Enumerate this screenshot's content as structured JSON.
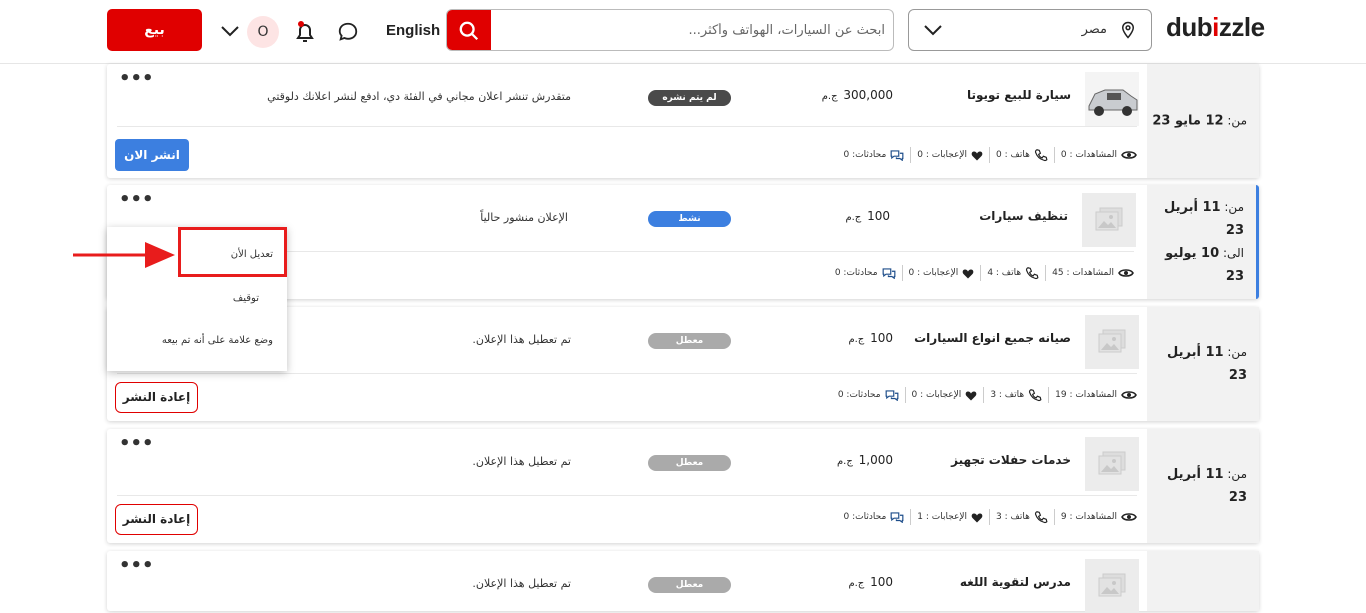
{
  "header": {
    "logo": "dubizzle",
    "location": "مصر",
    "search_placeholder": "ابحث عن السيارات، الهواتف وأكثر...",
    "language": "English",
    "avatar_letter": "O",
    "sell_label": "بيع"
  },
  "menu": {
    "items": [
      "تعديل الأن",
      "توقيف",
      "وضع علامة على أنه تم بيعه"
    ]
  },
  "listings": [
    {
      "date_from_label": "من:",
      "date_from": "12 مايو 23",
      "title": "سيارة للبيع تويوتا",
      "price": "300,000",
      "currency": "ج.م",
      "status": "لم يتم نشره",
      "note": "متقدرش تنشر اعلان مجاني في الفئة دي، ادفع لنشر اعلانك دلوقتي",
      "views": "المشاهدات : 0",
      "phone": "هاتف : 0",
      "likes": "الإعجابات : 0",
      "chats": "محادثات: 0",
      "action": "انشر الان"
    },
    {
      "date_from_label": "من:",
      "date_from": "11 أبريل 23",
      "date_to_label": "الى:",
      "date_to": "10 يوليو 23",
      "title": "تنظيف سيارات",
      "price": "100",
      "currency": "ج.م",
      "status": "نشط",
      "note": "الإعلان منشور حالياً",
      "views": "المشاهدات : 45",
      "phone": "هاتف : 4",
      "likes": "الإعجابات : 0",
      "chats": "محادثات: 0"
    },
    {
      "date_from_label": "من:",
      "date_from": "11 أبريل 23",
      "title": "صيانه جميع انواع السيارات",
      "price": "100",
      "currency": "ج.م",
      "status": "معطل",
      "note": "تم تعطيل هذا الإعلان.",
      "views": "المشاهدات : 19",
      "phone": "هاتف : 3",
      "likes": "الإعجابات : 0",
      "chats": "محادثات: 0",
      "action": "إعادة النشر"
    },
    {
      "date_from_label": "من:",
      "date_from": "11 أبريل 23",
      "title": "خدمات حفلات تجهيز",
      "price": "1,000",
      "currency": "ج.م",
      "status": "معطل",
      "note": "تم تعطيل هذا الإعلان.",
      "views": "المشاهدات : 9",
      "phone": "هاتف : 3",
      "likes": "الإعجابات : 1",
      "chats": "محادثات: 0",
      "action": "إعادة النشر"
    },
    {
      "title": "مدرس لتقوية اللغه",
      "price": "100",
      "currency": "ج.م",
      "status": "معطل",
      "note": "تم تعطيل هذا الإعلان."
    }
  ],
  "colors": {
    "brand_red": "#e00000",
    "active_blue": "#3c7fe0",
    "disabled_gray": "#aaaaaa"
  }
}
